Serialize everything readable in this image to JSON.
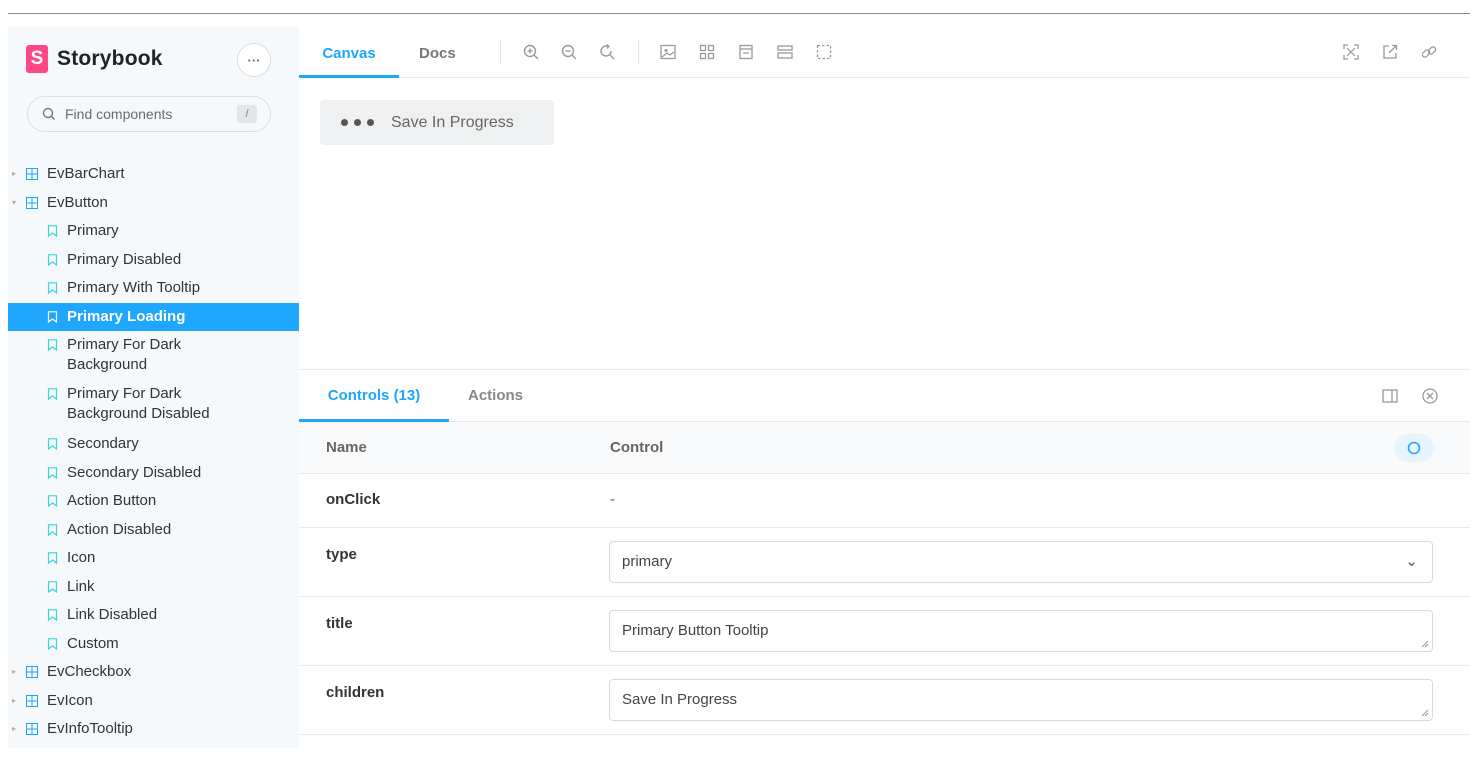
{
  "sidebar": {
    "brand": "Storybook",
    "logo_letter": "S",
    "menu_label": "···",
    "search_placeholder": "Find components",
    "search_shortcut": "/",
    "tree": [
      {
        "label": "EvBarChart",
        "kind": "component",
        "expanded": false
      },
      {
        "label": "EvButton",
        "kind": "component",
        "expanded": true
      },
      {
        "label": "Primary",
        "kind": "story"
      },
      {
        "label": "Primary Disabled",
        "kind": "story"
      },
      {
        "label": "Primary With Tooltip",
        "kind": "story"
      },
      {
        "label": "Primary Loading",
        "kind": "story",
        "active": true
      },
      {
        "label": "Primary For Dark Background",
        "kind": "story"
      },
      {
        "label": "Primary For Dark Background Disabled",
        "kind": "story"
      },
      {
        "label": "Secondary",
        "kind": "story"
      },
      {
        "label": "Secondary Disabled",
        "kind": "story"
      },
      {
        "label": "Action Button",
        "kind": "story"
      },
      {
        "label": "Action Disabled",
        "kind": "story"
      },
      {
        "label": "Icon",
        "kind": "story"
      },
      {
        "label": "Link",
        "kind": "story"
      },
      {
        "label": "Link Disabled",
        "kind": "story"
      },
      {
        "label": "Custom",
        "kind": "story"
      },
      {
        "label": "EvCheckbox",
        "kind": "component",
        "expanded": false
      },
      {
        "label": "EvIcon",
        "kind": "component",
        "expanded": false
      },
      {
        "label": "EvInfoTooltip",
        "kind": "component",
        "expanded": false
      }
    ]
  },
  "toolbar": {
    "tabs": [
      "Canvas",
      "Docs"
    ],
    "active_tab": "Canvas",
    "tools": [
      "zoom-in-icon",
      "zoom-out-icon",
      "zoom-reset-icon",
      "background-icon",
      "grid-icon",
      "viewport-icon",
      "measure-icon",
      "outline-icon"
    ],
    "right_tools": [
      "fullscreen-icon",
      "open-new-tab-icon",
      "copy-link-icon"
    ]
  },
  "preview": {
    "button_label": "Save In Progress"
  },
  "addons": {
    "tabs": [
      "Controls (13)",
      "Actions"
    ],
    "active_tab": "Controls (13)",
    "header": {
      "name": "Name",
      "control": "Control"
    },
    "rows": [
      {
        "name": "onClick",
        "control_type": "none",
        "value": "-"
      },
      {
        "name": "type",
        "control_type": "select",
        "value": "primary"
      },
      {
        "name": "title",
        "control_type": "text",
        "value": "Primary Button Tooltip"
      },
      {
        "name": "children",
        "control_type": "text",
        "value": "Save In Progress"
      }
    ]
  },
  "colors": {
    "accent": "#1ea7fd",
    "brand": "#ff4785",
    "sidebar_bg": "#f6f9fc"
  }
}
